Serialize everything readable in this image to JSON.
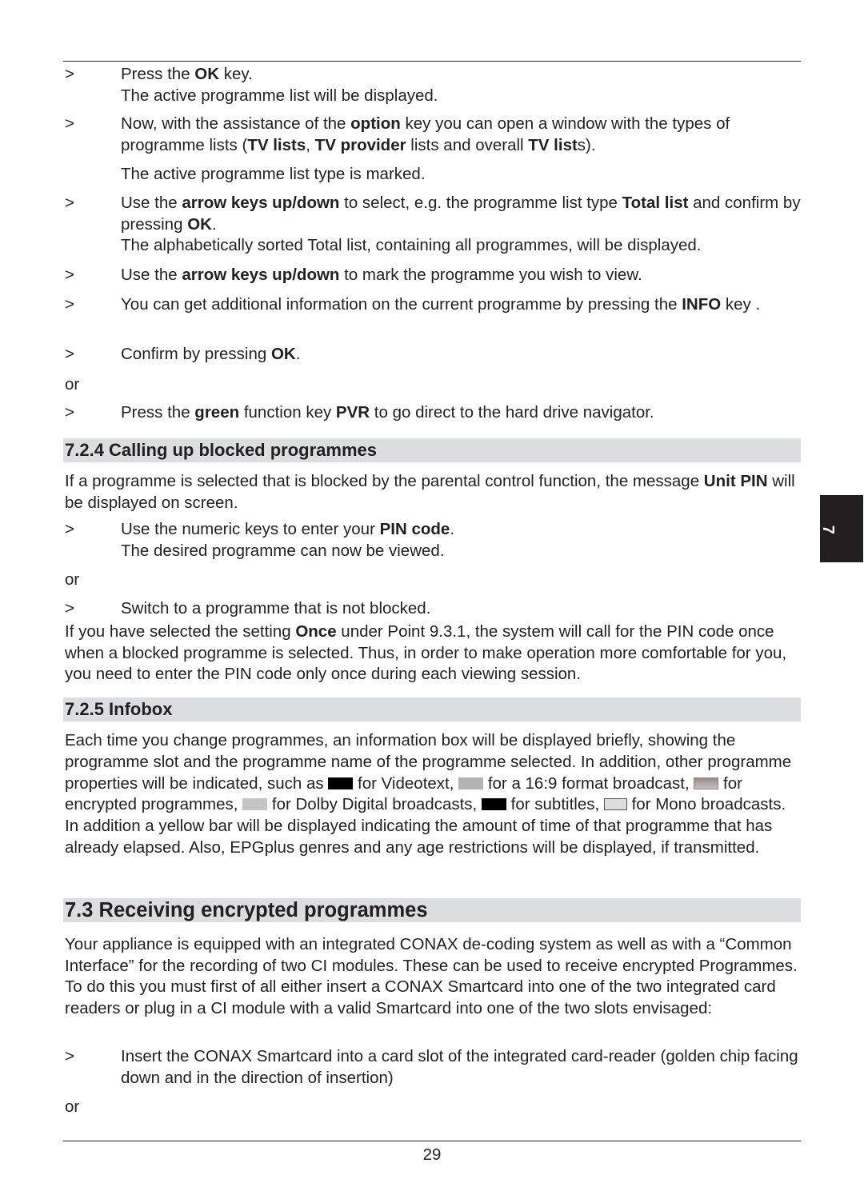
{
  "top_steps": [
    {
      "marker": ">",
      "parts": [
        "Press the ",
        {
          "b": "OK"
        },
        " key."
      ],
      "sub": "The active programme list will be displayed."
    },
    {
      "marker": ">",
      "parts": [
        "Now, with the assistance of the ",
        {
          "b": "option"
        },
        " key you can open a window with the types of programme lists (",
        {
          "b": "TV lists"
        },
        ", ",
        {
          "b": "TV provider"
        },
        " lists and overall ",
        {
          "b": "TV list"
        },
        "s)."
      ],
      "sub": "The active programme list type is marked."
    },
    {
      "marker": ">",
      "parts": [
        "Use the ",
        {
          "b": "arrow keys up/down"
        },
        " to select, e.g. the programme list type ",
        {
          "b": "Total list"
        },
        " and confirm by pressing ",
        {
          "b": "OK"
        },
        "."
      ],
      "sub": "The alphabetically sorted Total list, containing all programmes, will be displayed."
    },
    {
      "marker": ">",
      "parts": [
        "Use the ",
        {
          "b": "arrow keys up/down"
        },
        " to mark the programme you wish to view."
      ]
    },
    {
      "marker": ">",
      "parts": [
        "You can get additional information on the current programme by pressing the ",
        {
          "b": "INFO"
        },
        " key ."
      ]
    },
    {
      "marker": ">",
      "parts": [
        "Confirm by pressing ",
        {
          "b": "OK"
        },
        "."
      ]
    }
  ],
  "or_label": "or",
  "pvr_step": {
    "marker": ">",
    "parts": [
      "Press the ",
      {
        "b": "green"
      },
      " function key ",
      {
        "b": "PVR"
      },
      " to go direct to the hard drive navigator."
    ]
  },
  "section_724": {
    "title": "7.2.4 Calling up blocked programmes",
    "intro": [
      "If a programme is selected that is blocked by the parental control function, the message ",
      {
        "b": "Unit PIN"
      },
      " will be displayed on screen."
    ],
    "step1": {
      "marker": ">",
      "parts": [
        "Use the numeric keys to enter your ",
        {
          "b": "PIN code"
        },
        "."
      ],
      "sub": "The desired programme can now be viewed."
    },
    "step2": {
      "marker": ">",
      "parts": [
        "Switch to a programme that is not blocked."
      ]
    },
    "outro": [
      "If you have selected the setting ",
      {
        "b": "Once"
      },
      " under Point 9.3.1, the system will call for the PIN code once when a blocked programme is selected. Thus, in order to make operation more comfortable for you, you need to enter the PIN code only once during each viewing session."
    ]
  },
  "section_725": {
    "title": "7.2.5 Infobox",
    "text_a": "Each time you change programmes, an information box will be displayed briefly, showing the programme slot and the programme name of the programme selected. In addition, other programme properties will be indicated, such as ",
    "icons": [
      {
        "icon": "videotext-icon",
        "text": " for Videotext, "
      },
      {
        "icon": "16-9-format-icon",
        "text": " for a 16:9 format broadcast, "
      },
      {
        "icon": "encrypted-icon",
        "text": " for encrypted programmes, "
      },
      {
        "icon": "dolby-digital-icon",
        "text": " for Dolby Digital broadcasts, "
      },
      {
        "icon": "subtitles-icon",
        "text": " for subtitles, "
      },
      {
        "icon": "mono-icon",
        "text": " for Mono broadcasts. "
      }
    ],
    "text_b": "In addition a yellow bar will be displayed indicating the amount of time of that programme that has already elapsed. Also, EPGplus genres and any age restrictions will be displayed, if transmitted."
  },
  "section_73": {
    "title": "7.3 Receiving encrypted programmes",
    "intro": "Your appliance is equipped with an integrated CONAX de-coding system as well as with a “Common Interface” for the recording of two CI modules. These can be used to receive encrypted Programmes. To do this you must first of all either insert a CONAX Smartcard into one of the two integrated card readers or plug in a CI module with a valid Smartcard into one of the two slots envisaged:",
    "step1": {
      "marker": ">",
      "parts": [
        "Insert the CONAX Smartcard into a card slot of the integrated card-reader (golden chip facing down and in the direction of insertion)"
      ]
    }
  },
  "chapter_tab": "7",
  "page_number": "29"
}
